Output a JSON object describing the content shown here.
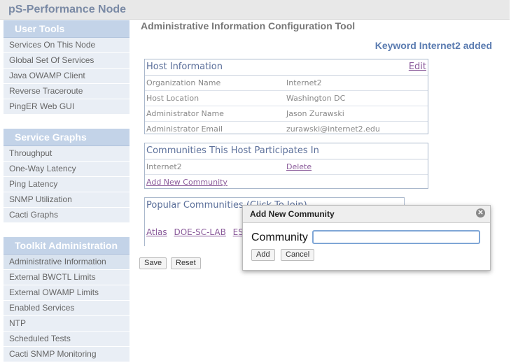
{
  "app": {
    "title": "pS-Performance Node"
  },
  "sidebar": {
    "sections": [
      {
        "title": "User Tools",
        "items": [
          "Services On This Node",
          "Global Set Of Services",
          "Java OWAMP Client",
          "Reverse Traceroute",
          "PingER Web GUI"
        ]
      },
      {
        "title": "Service Graphs",
        "items": [
          "Throughput",
          "One-Way Latency",
          "Ping Latency",
          "SNMP Utilization",
          "Cacti Graphs"
        ]
      },
      {
        "title": "Toolkit Administration",
        "items": [
          "Administrative Information",
          "External BWCTL Limits",
          "External OWAMP Limits",
          "Enabled Services",
          "NTP",
          "Scheduled Tests",
          "Cacti SNMP Monitoring"
        ],
        "active": "Administrative Information"
      }
    ]
  },
  "main": {
    "title": "Administrative Information Configuration Tool",
    "status": "Keyword Internet2 added",
    "host_info": {
      "heading": "Host Information",
      "edit_label": "Edit",
      "rows": [
        {
          "label": "Organization Name",
          "value": "Internet2"
        },
        {
          "label": "Host Location",
          "value": "Washington DC"
        },
        {
          "label": "Administrator Name",
          "value": "Jason Zurawski"
        },
        {
          "label": "Administrator Email",
          "value": "zurawski@internet2.edu"
        }
      ]
    },
    "communities": {
      "heading": "Communities This Host Participates In",
      "items": [
        {
          "name": "Internet2",
          "action": "Delete"
        }
      ],
      "add_label": "Add New Community"
    },
    "popular": {
      "heading": "Popular Communities (Click To Join)",
      "links": [
        "Atlas",
        "DOE-SC-LAB",
        "ESn"
      ]
    },
    "buttons": {
      "save": "Save",
      "reset": "Reset"
    }
  },
  "dialog": {
    "title": "Add New Community",
    "close_icon": "close-icon",
    "field_label": "Community",
    "field_value": "",
    "add_label": "Add",
    "cancel_label": "Cancel"
  }
}
